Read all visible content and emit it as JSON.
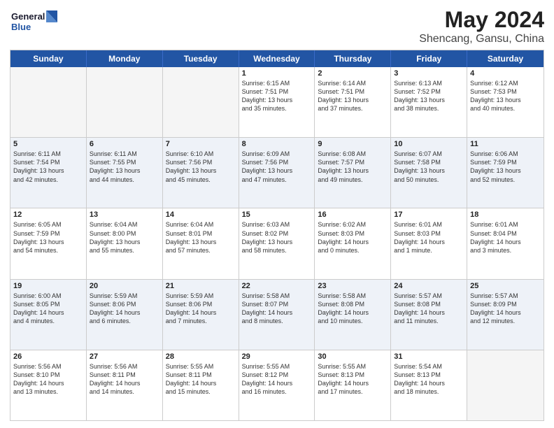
{
  "header": {
    "logo_line1": "General",
    "logo_line2": "Blue",
    "title": "May 2024",
    "subtitle": "Shencang, Gansu, China"
  },
  "days": [
    "Sunday",
    "Monday",
    "Tuesday",
    "Wednesday",
    "Thursday",
    "Friday",
    "Saturday"
  ],
  "weeks": [
    [
      {
        "day": "",
        "info": ""
      },
      {
        "day": "",
        "info": ""
      },
      {
        "day": "",
        "info": ""
      },
      {
        "day": "1",
        "info": "Sunrise: 6:15 AM\nSunset: 7:51 PM\nDaylight: 13 hours\nand 35 minutes."
      },
      {
        "day": "2",
        "info": "Sunrise: 6:14 AM\nSunset: 7:51 PM\nDaylight: 13 hours\nand 37 minutes."
      },
      {
        "day": "3",
        "info": "Sunrise: 6:13 AM\nSunset: 7:52 PM\nDaylight: 13 hours\nand 38 minutes."
      },
      {
        "day": "4",
        "info": "Sunrise: 6:12 AM\nSunset: 7:53 PM\nDaylight: 13 hours\nand 40 minutes."
      }
    ],
    [
      {
        "day": "5",
        "info": "Sunrise: 6:11 AM\nSunset: 7:54 PM\nDaylight: 13 hours\nand 42 minutes."
      },
      {
        "day": "6",
        "info": "Sunrise: 6:11 AM\nSunset: 7:55 PM\nDaylight: 13 hours\nand 44 minutes."
      },
      {
        "day": "7",
        "info": "Sunrise: 6:10 AM\nSunset: 7:56 PM\nDaylight: 13 hours\nand 45 minutes."
      },
      {
        "day": "8",
        "info": "Sunrise: 6:09 AM\nSunset: 7:56 PM\nDaylight: 13 hours\nand 47 minutes."
      },
      {
        "day": "9",
        "info": "Sunrise: 6:08 AM\nSunset: 7:57 PM\nDaylight: 13 hours\nand 49 minutes."
      },
      {
        "day": "10",
        "info": "Sunrise: 6:07 AM\nSunset: 7:58 PM\nDaylight: 13 hours\nand 50 minutes."
      },
      {
        "day": "11",
        "info": "Sunrise: 6:06 AM\nSunset: 7:59 PM\nDaylight: 13 hours\nand 52 minutes."
      }
    ],
    [
      {
        "day": "12",
        "info": "Sunrise: 6:05 AM\nSunset: 7:59 PM\nDaylight: 13 hours\nand 54 minutes."
      },
      {
        "day": "13",
        "info": "Sunrise: 6:04 AM\nSunset: 8:00 PM\nDaylight: 13 hours\nand 55 minutes."
      },
      {
        "day": "14",
        "info": "Sunrise: 6:04 AM\nSunset: 8:01 PM\nDaylight: 13 hours\nand 57 minutes."
      },
      {
        "day": "15",
        "info": "Sunrise: 6:03 AM\nSunset: 8:02 PM\nDaylight: 13 hours\nand 58 minutes."
      },
      {
        "day": "16",
        "info": "Sunrise: 6:02 AM\nSunset: 8:03 PM\nDaylight: 14 hours\nand 0 minutes."
      },
      {
        "day": "17",
        "info": "Sunrise: 6:01 AM\nSunset: 8:03 PM\nDaylight: 14 hours\nand 1 minute."
      },
      {
        "day": "18",
        "info": "Sunrise: 6:01 AM\nSunset: 8:04 PM\nDaylight: 14 hours\nand 3 minutes."
      }
    ],
    [
      {
        "day": "19",
        "info": "Sunrise: 6:00 AM\nSunset: 8:05 PM\nDaylight: 14 hours\nand 4 minutes."
      },
      {
        "day": "20",
        "info": "Sunrise: 5:59 AM\nSunset: 8:06 PM\nDaylight: 14 hours\nand 6 minutes."
      },
      {
        "day": "21",
        "info": "Sunrise: 5:59 AM\nSunset: 8:06 PM\nDaylight: 14 hours\nand 7 minutes."
      },
      {
        "day": "22",
        "info": "Sunrise: 5:58 AM\nSunset: 8:07 PM\nDaylight: 14 hours\nand 8 minutes."
      },
      {
        "day": "23",
        "info": "Sunrise: 5:58 AM\nSunset: 8:08 PM\nDaylight: 14 hours\nand 10 minutes."
      },
      {
        "day": "24",
        "info": "Sunrise: 5:57 AM\nSunset: 8:08 PM\nDaylight: 14 hours\nand 11 minutes."
      },
      {
        "day": "25",
        "info": "Sunrise: 5:57 AM\nSunset: 8:09 PM\nDaylight: 14 hours\nand 12 minutes."
      }
    ],
    [
      {
        "day": "26",
        "info": "Sunrise: 5:56 AM\nSunset: 8:10 PM\nDaylight: 14 hours\nand 13 minutes."
      },
      {
        "day": "27",
        "info": "Sunrise: 5:56 AM\nSunset: 8:11 PM\nDaylight: 14 hours\nand 14 minutes."
      },
      {
        "day": "28",
        "info": "Sunrise: 5:55 AM\nSunset: 8:11 PM\nDaylight: 14 hours\nand 15 minutes."
      },
      {
        "day": "29",
        "info": "Sunrise: 5:55 AM\nSunset: 8:12 PM\nDaylight: 14 hours\nand 16 minutes."
      },
      {
        "day": "30",
        "info": "Sunrise: 5:55 AM\nSunset: 8:13 PM\nDaylight: 14 hours\nand 17 minutes."
      },
      {
        "day": "31",
        "info": "Sunrise: 5:54 AM\nSunset: 8:13 PM\nDaylight: 14 hours\nand 18 minutes."
      },
      {
        "day": "",
        "info": ""
      }
    ]
  ]
}
